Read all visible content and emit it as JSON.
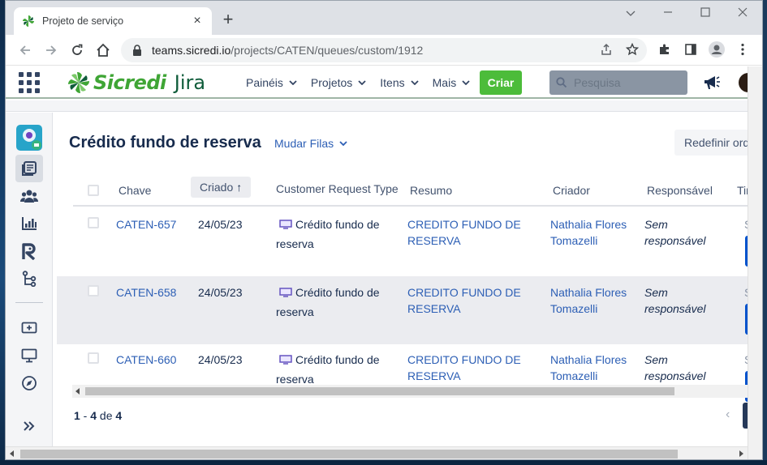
{
  "browser": {
    "tab_title": "Projeto de serviço",
    "tab_close": "×",
    "new_tab": "+",
    "window_controls": {
      "minimize": "⌄",
      "restore": "–",
      "maximize": "☐",
      "close": "✕"
    },
    "url_host": "teams.sicredi.io",
    "url_path": "/projects/CATEN/queues/custom/1912"
  },
  "jira": {
    "brand": "Sicredi",
    "product": "Jira",
    "nav": [
      {
        "label": "Painéis",
        "chev": "⌄"
      },
      {
        "label": "Projetos",
        "chev": "⌄"
      },
      {
        "label": "Itens",
        "chev": "⌄"
      },
      {
        "label": "Mais",
        "chev": "⌄"
      }
    ],
    "create_label": "Criar",
    "search_placeholder": "Pesquisa",
    "colors": {
      "green": "#4cbc3a",
      "link": "#2d5fb5",
      "brand_green": "#3fa535"
    }
  },
  "page": {
    "title": "Crédito fundo de reserva",
    "change_queue": "Mudar Filas",
    "change_queue_chev": "⌄",
    "reset_button": "Redefinir ordem"
  },
  "table": {
    "headers": {
      "key": "Chave",
      "created": "Criado",
      "created_sort": "↑",
      "request_type": "Customer Request Type",
      "summary": "Resumo",
      "reporter": "Criador",
      "assignee": "Responsável",
      "time": "Tim"
    },
    "rows": [
      {
        "key": "CATEN-657",
        "created": "24/05/23",
        "type_line1": "Crédito fundo de",
        "type_line2": "reserva",
        "summary_line1": "CREDITO FUNDO DE",
        "summary_line2": "RESERVA",
        "reporter_line1": "Nathalia Flores",
        "reporter_line2": "Tomazelli",
        "assignee_line1": "Sem",
        "assignee_line2": "responsável",
        "time": "Sl"
      },
      {
        "key": "CATEN-658",
        "created": "24/05/23",
        "type_line1": "Crédito fundo de",
        "type_line2": "reserva",
        "summary_line1": "CREDITO FUNDO DE",
        "summary_line2": "RESERVA",
        "reporter_line1": "Nathalia Flores",
        "reporter_line2": "Tomazelli",
        "assignee_line1": "Sem",
        "assignee_line2": "responsável",
        "time": "Sl"
      },
      {
        "key": "CATEN-660",
        "created": "24/05/23",
        "type_line1": "Crédito fundo de",
        "type_line2": "reserva",
        "summary_line1": "CREDITO FUNDO DE",
        "summary_line2": "RESERVA",
        "reporter_line1": "Nathalia Flores",
        "reporter_line2": "Tomazelli",
        "assignee_line1": "Sem",
        "assignee_line2": "responsável",
        "time": "Sl"
      }
    ]
  },
  "pagination": {
    "from": "1",
    "dash": " - ",
    "to": "4",
    "of": " de ",
    "total": "4",
    "prev": "‹"
  }
}
